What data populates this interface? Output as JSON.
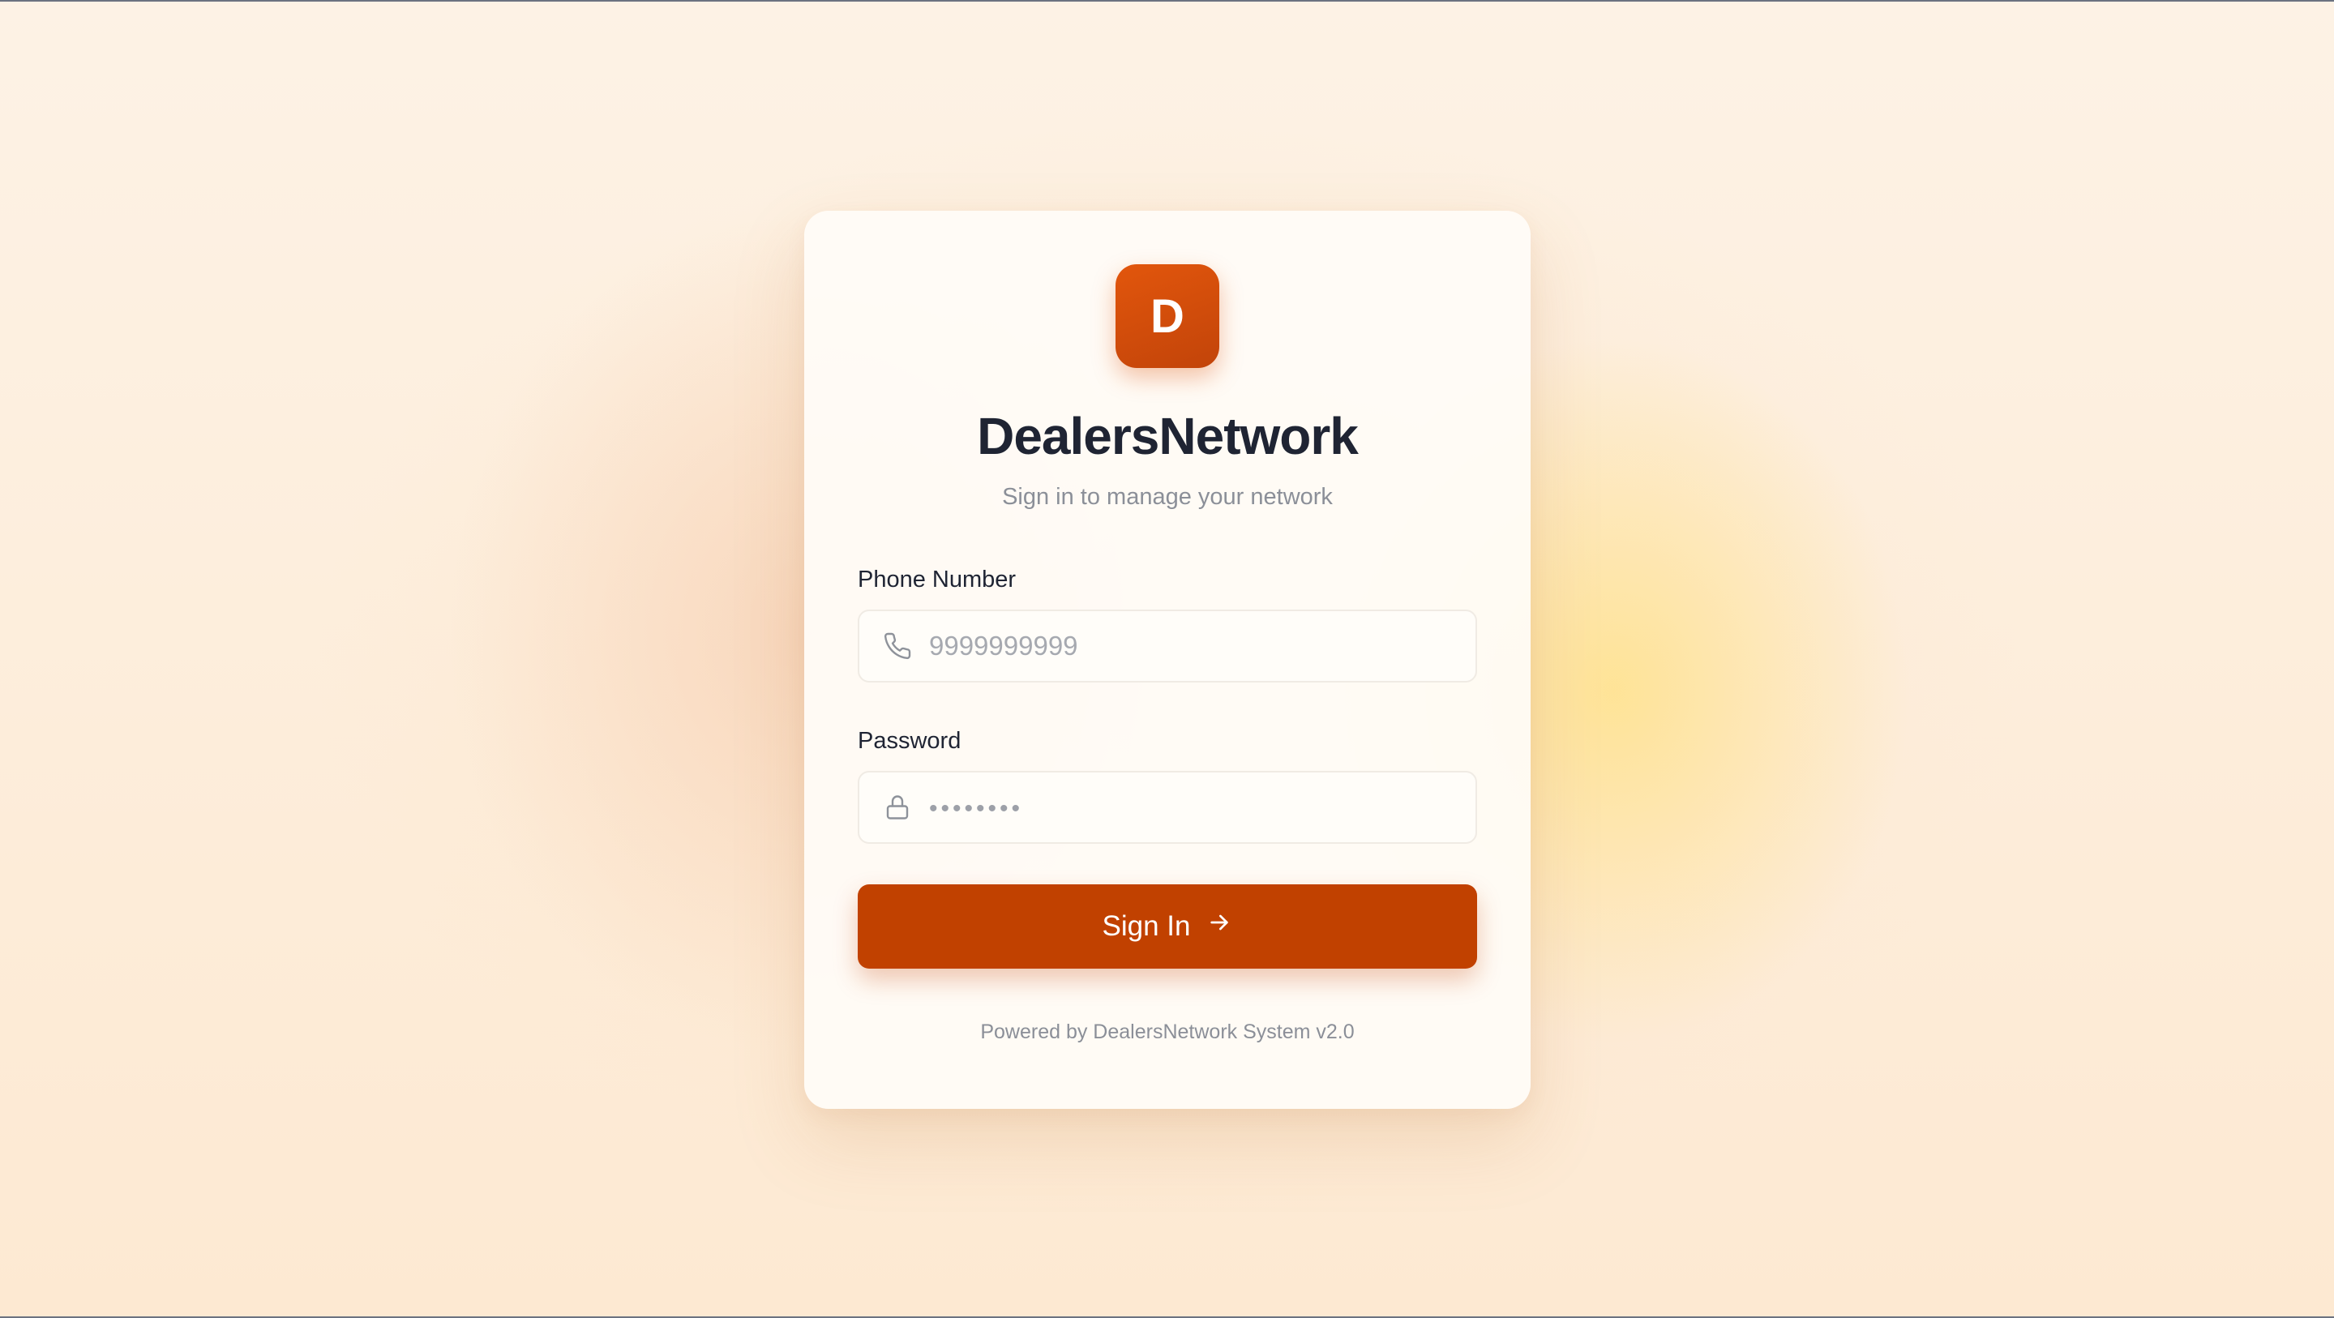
{
  "brand": {
    "logo_letter": "D",
    "name": "DealersNetwork",
    "tagline": "Sign in to manage your network"
  },
  "form": {
    "phone": {
      "label": "Phone Number",
      "placeholder": "9999999999",
      "icon": "phone-icon"
    },
    "password": {
      "label": "Password",
      "placeholder": "••••••••",
      "icon": "lock-icon"
    },
    "submit_label": "Sign In",
    "submit_icon": "arrow-right-icon"
  },
  "footer": {
    "text": "Powered by DealersNetwork System v2.0"
  },
  "colors": {
    "accent": "#c14100",
    "logo": "#e2560c",
    "title": "#1f2433",
    "muted": "#8b8f98"
  }
}
